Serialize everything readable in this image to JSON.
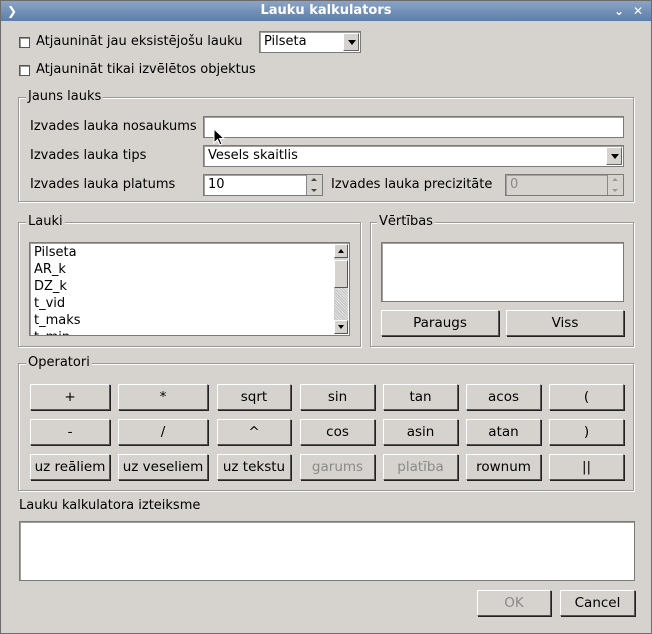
{
  "window": {
    "title": "Lauku kalkulators"
  },
  "options": {
    "update_existing_label": "Atjaunināt jau eksistējošu lauku",
    "update_existing_field_value": "Pilseta",
    "update_selected_only_label": "Atjaunināt tikai izvēlētos objektus"
  },
  "new_field": {
    "group_title": "Jauns lauks",
    "name_label": "Izvades lauka nosaukums",
    "name_value": "",
    "type_label": "Izvades lauka tips",
    "type_value": "Vesels skaitlis",
    "width_label": "Izvades lauka platums",
    "width_value": "10",
    "precision_label": "Izvades lauka precizitāte",
    "precision_value": "0"
  },
  "fields": {
    "group_title": "Lauki",
    "items": [
      "Pilseta",
      "AR_k",
      "DZ_k",
      "t_vid",
      "t_maks",
      "t_min"
    ]
  },
  "values": {
    "group_title": "Vērtības",
    "sample_button": "Paraugs",
    "all_button": "Viss"
  },
  "operators": {
    "group_title": "Operatori",
    "row1": [
      "+",
      "*",
      "sqrt",
      "sin",
      "tan",
      "acos",
      "("
    ],
    "row2": [
      "-",
      "/",
      "^",
      "cos",
      "asin",
      "atan",
      ")"
    ],
    "row3": [
      "uz reāliem",
      "uz veseliem",
      "uz tekstu",
      "garums",
      "platība",
      "rownum",
      "||"
    ],
    "row3_disabled": [
      false,
      false,
      false,
      true,
      true,
      false,
      false
    ]
  },
  "expression": {
    "label": "Lauku kalkulatora izteiksme",
    "value": ""
  },
  "buttons": {
    "ok": "OK",
    "cancel": "Cancel"
  }
}
